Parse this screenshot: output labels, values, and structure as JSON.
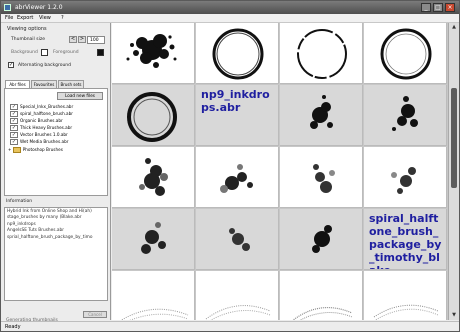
{
  "window": {
    "title": "abrViewer 1.2.0",
    "minimize": "_",
    "maximize": "□",
    "close": "×"
  },
  "menu": [
    "File",
    "Export",
    "View",
    "?"
  ],
  "viewing_options": {
    "group_title": "Viewing options",
    "thumbnail_size_label": "Thumbnail size",
    "thumbnail_size_value": "100",
    "background_label": "Background",
    "foreground_label": "Foreground",
    "alternating_label": "Alternating background",
    "colors": {
      "background": "#ffffff",
      "foreground": "#000000"
    }
  },
  "tabs": [
    "Abr files",
    "Favourites",
    "Brush sets"
  ],
  "load_button": "Load new files",
  "files": [
    {
      "name": "Special_Inkx_Brushes.abr",
      "checked": true
    },
    {
      "name": "spiral_halftone_brush.abr",
      "checked": true
    },
    {
      "name": "Organic Brushes.abr",
      "checked": true
    },
    {
      "name": "Thick Heavy Brushes.abr",
      "checked": true
    },
    {
      "name": "Vector Brushes 1.0.abr",
      "checked": true
    },
    {
      "name": "Wet Media Brushes.abr",
      "checked": true
    }
  ],
  "folder": "Photoshop Brushes",
  "info_label": "Information",
  "info_text": [
    "Hybrid Ink from Online Shop and Hi(ah)",
    "stage_brushes by many (Blake.abr",
    "np9_inkdrops",
    "AngelsSE Tuts Brushes.abr",
    "sprial_halftone_brush_package_by_timo"
  ],
  "progress_label": "Generating thumbnails",
  "progress": 0.85,
  "cancel_label": "Cancel",
  "status": "Ready",
  "gallery_labels": {
    "inkdrops": "np9_inkdrops.abr",
    "halftone": "spiral_halftone_brush_package_by_timothy_blake"
  },
  "scroll": {
    "up": "▲",
    "down": "▼"
  },
  "icons": {
    "app": "brush-app-icon",
    "file": "file-icon",
    "folder": "folder-icon"
  }
}
